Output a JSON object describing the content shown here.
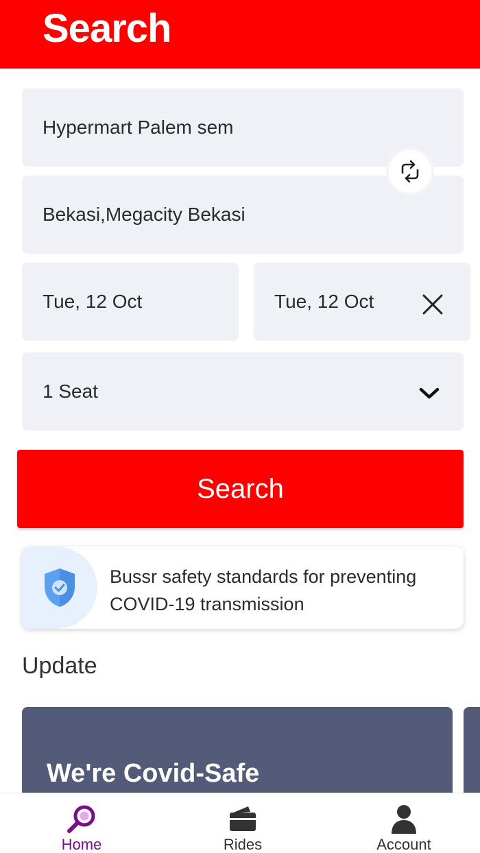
{
  "header": {
    "title": "Search"
  },
  "form": {
    "origin": "Hypermart Palem sem",
    "destination": "Bekasi,Megacity Bekasi",
    "depart_date": "Tue, 12 Oct",
    "return_date": "Tue, 12 Oct",
    "seats": "1 Seat",
    "swap_icon": "swap-arrows-icon",
    "clear_icon": "close-icon",
    "dropdown_icon": "chevron-down-icon"
  },
  "search_button": {
    "label": "Search"
  },
  "safety_card": {
    "icon": "shield-check-icon",
    "text": "Bussr safety standards for preventing COVID-19 transmission"
  },
  "updates": {
    "title": "Update",
    "cards": [
      {
        "title": "We're Covid-Safe"
      }
    ]
  },
  "bottom_nav": {
    "items": [
      {
        "label": "Home",
        "icon": "search-icon",
        "active": true
      },
      {
        "label": "Rides",
        "icon": "wallet-icon",
        "active": false
      },
      {
        "label": "Account",
        "icon": "person-icon",
        "active": false
      }
    ]
  },
  "colors": {
    "primary": "#ff0000",
    "field_bg": "#eff1f6",
    "active_nav": "#7a0f8c",
    "card_bg": "#545b78"
  }
}
